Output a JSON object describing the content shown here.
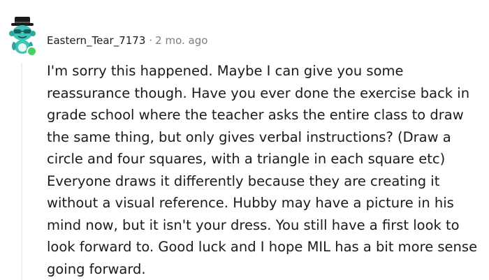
{
  "comment": {
    "username": "Eastern_Tear_7173",
    "separator": "·",
    "timestamp": "2 mo. ago",
    "online_status_color": "#46d160",
    "body": "I'm sorry this happened. Maybe I can give you some reassurance though. Have you ever done the exercise back in grade school where the teacher asks the entire class to draw the same thing, but only gives verbal instructions? (Draw a circle and four squares, with a triangle in each square etc) Everyone draws it differently because they are creating it without a visual reference. Hubby may have a picture in his mind now, but it isn't your dress. You still have a first look to look forward to. Good luck and I hope MIL has a bit more sense going forward."
  },
  "avatar": {
    "icon": "snoo-avatar-icon",
    "hat_color": "#1a1a1b",
    "face_color": "#3fc4b8"
  }
}
